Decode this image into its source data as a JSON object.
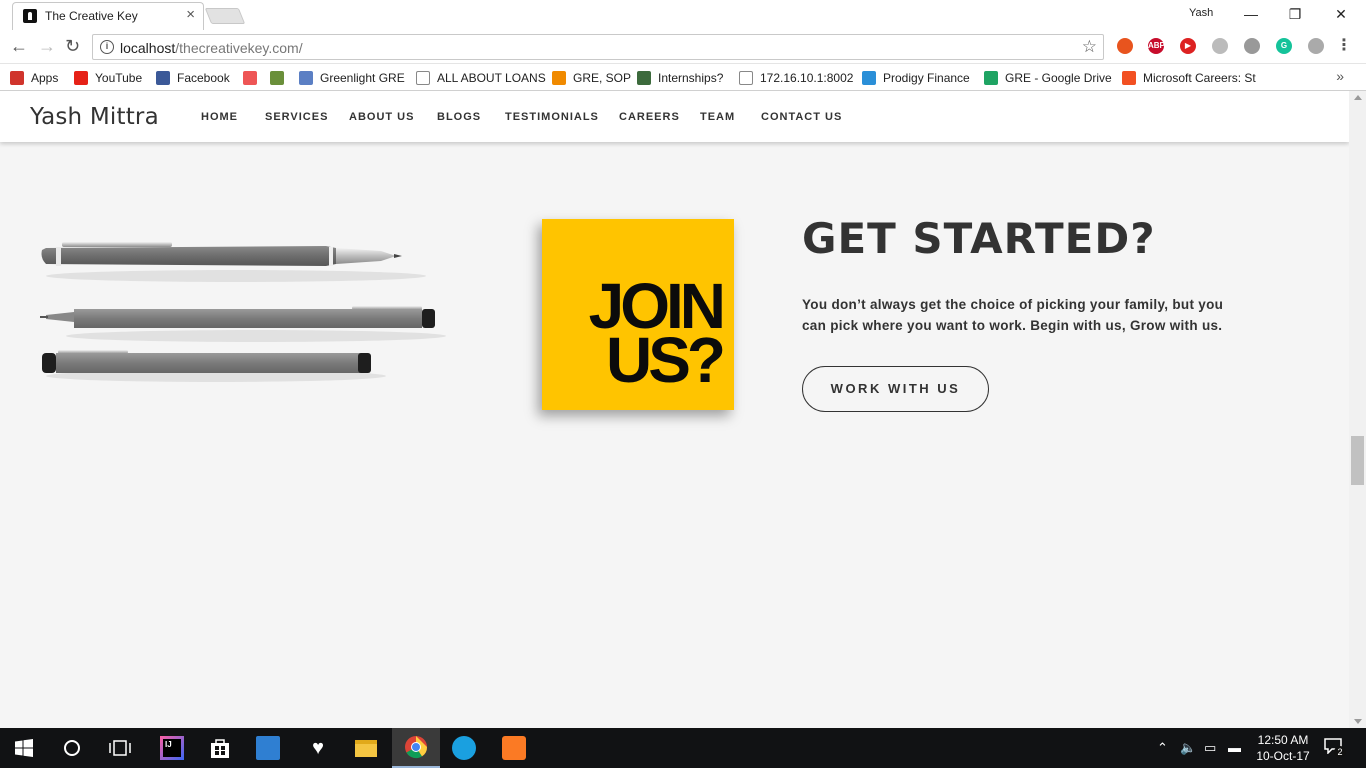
{
  "browser": {
    "tab_title": "The Creative Key",
    "tab_close": "×",
    "profile_name": "Yash",
    "window_buttons": {
      "minimize": "—",
      "restore": "❐",
      "close": "✕"
    },
    "url_host": "localhost",
    "url_path": "/thecreativekey.com/",
    "extensions": [
      {
        "name": "extension-fire-icon",
        "label": "",
        "color": "#e8541e"
      },
      {
        "name": "adblock-plus-icon",
        "label": "ABP",
        "color": "#c70d2c"
      },
      {
        "name": "extension-red-play-icon",
        "label": "▶",
        "color": "#d22"
      },
      {
        "name": "extension-gray-icon",
        "label": "",
        "color": "#bbb"
      },
      {
        "name": "extension-gray-2-icon",
        "label": "",
        "color": "#999"
      },
      {
        "name": "grammarly-icon",
        "label": "G",
        "color": "#15c39a"
      },
      {
        "name": "camera-icon",
        "label": "",
        "color": "#aaa"
      }
    ]
  },
  "bookmarks": [
    {
      "label": "Apps",
      "color": "#d0342c"
    },
    {
      "label": "YouTube",
      "color": "#e62117"
    },
    {
      "label": "Facebook",
      "color": "#3b5998"
    },
    {
      "label": "",
      "color": "#e55"
    },
    {
      "label": "",
      "color": "#6a8f3a"
    },
    {
      "label": "Greenlight GRE",
      "color": "#5b7fc4"
    },
    {
      "label": "ALL ABOUT LOANS",
      "color": "#ffffff"
    },
    {
      "label": "GRE, SOP",
      "color": "#f08a00"
    },
    {
      "label": "Internships?",
      "color": "#3c6a3c"
    },
    {
      "label": "172.16.10.1:8002",
      "color": "#ffffff"
    },
    {
      "label": "Prodigy Finance",
      "color": "#2a8fd8"
    },
    {
      "label": "GRE - Google Drive",
      "color": "#1fa463"
    },
    {
      "label": "Microsoft Careers: St",
      "color": "#f25022"
    }
  ],
  "site": {
    "brand": "Yash Mittra",
    "nav": [
      "HOME",
      "SERVICES",
      "ABOUT US",
      "BLOGS",
      "TESTIMONIALS",
      "CAREERS",
      "TEAM",
      "CONTACT US"
    ],
    "join_line1": "JOIN",
    "join_line2": "US?",
    "cta_title": "GET STARTED?",
    "cta_text": "You don’t always get the choice of picking your family, but you can pick where you want to work. Begin with us, Grow with us.",
    "cta_button": "WORK WITH US",
    "accent_color": "#ffc400"
  },
  "taskbar": {
    "time": "12:50 AM",
    "date": "10-Oct-17",
    "notification_count": "2"
  }
}
